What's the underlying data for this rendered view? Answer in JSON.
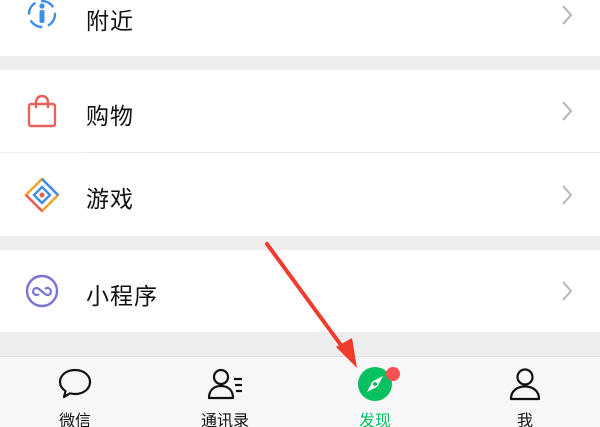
{
  "menu": {
    "items": [
      {
        "label": "附近",
        "icon": "nearby-person-icon"
      },
      {
        "label": "购物",
        "icon": "shopping-bag-icon"
      },
      {
        "label": "游戏",
        "icon": "game-diamond-icon"
      },
      {
        "label": "小程序",
        "icon": "mini-program-icon"
      }
    ]
  },
  "tabbar": {
    "tabs": [
      {
        "label": "微信",
        "icon": "chat-bubble-icon"
      },
      {
        "label": "通讯录",
        "icon": "contacts-icon"
      },
      {
        "label": "发现",
        "icon": "discover-compass-icon",
        "active": true,
        "badge": "red-dot"
      },
      {
        "label": "我",
        "icon": "me-person-icon"
      }
    ]
  },
  "colors": {
    "active_green": "#07c160",
    "badge_red": "#fa5151",
    "annotation_arrow": "#f03c2d"
  }
}
